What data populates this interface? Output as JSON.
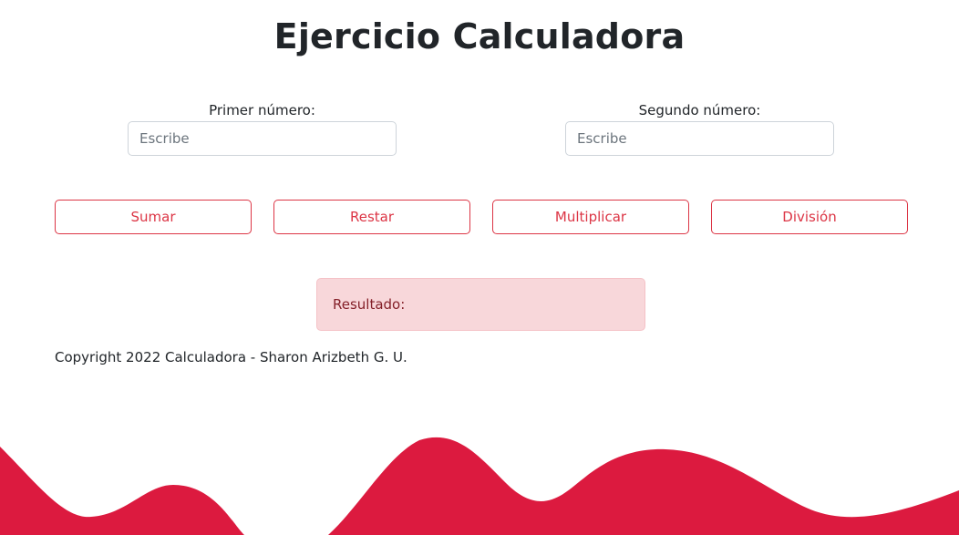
{
  "page": {
    "title": "Ejercicio Calculadora"
  },
  "form": {
    "first": {
      "label": "Primer número:",
      "placeholder": "Escribe",
      "value": ""
    },
    "second": {
      "label": "Segundo número:",
      "placeholder": "Escribe",
      "value": ""
    }
  },
  "buttons": {
    "sum": "Sumar",
    "subtract": "Restar",
    "multiply": "Multiplicar",
    "divide": "División"
  },
  "result": {
    "label": "Resultado:"
  },
  "footer": {
    "text": "Copyright 2022 Calculadora - Sharon Arizbeth G. U."
  },
  "colors": {
    "accent": "#dc3545",
    "wave": "#dc1a3f",
    "result_bg": "#f8d7da",
    "result_text": "#842029"
  }
}
